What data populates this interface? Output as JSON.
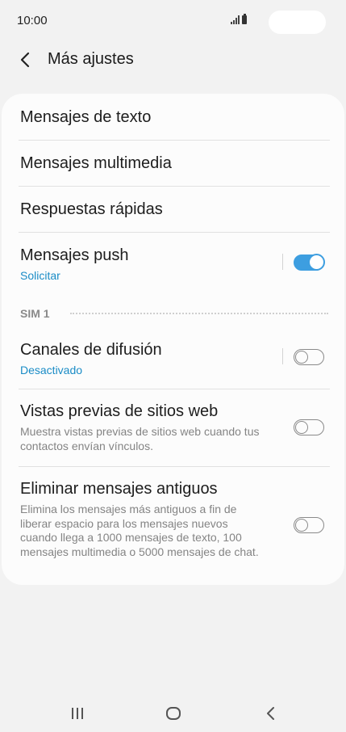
{
  "status": {
    "time": "10:00"
  },
  "header": {
    "title": "Más ajustes"
  },
  "settings": {
    "text_messages": {
      "label": "Mensajes de texto"
    },
    "multimedia_messages": {
      "label": "Mensajes multimedia"
    },
    "quick_responses": {
      "label": "Respuestas rápidas"
    },
    "push_messages": {
      "label": "Mensajes push",
      "sub": "Solicitar",
      "enabled": true
    },
    "section": {
      "label": "SIM 1"
    },
    "broadcast_channels": {
      "label": "Canales de difusión",
      "sub": "Desactivado",
      "enabled": false
    },
    "web_previews": {
      "label": "Vistas previas de sitios web",
      "desc": "Muestra vistas previas de sitios web cuando tus contactos envían vínculos.",
      "enabled": false
    },
    "delete_old": {
      "label": "Eliminar mensajes antiguos",
      "desc": "Elimina los mensajes más antiguos a fin de liberar espacio para los mensajes nuevos cuando llega a 1000 mensajes de texto, 100 mensajes multimedia o 5000 mensajes de chat.",
      "enabled": false
    }
  },
  "colors": {
    "accent": "#3d9ee0",
    "subtext_accent": "#1a8cc6"
  }
}
